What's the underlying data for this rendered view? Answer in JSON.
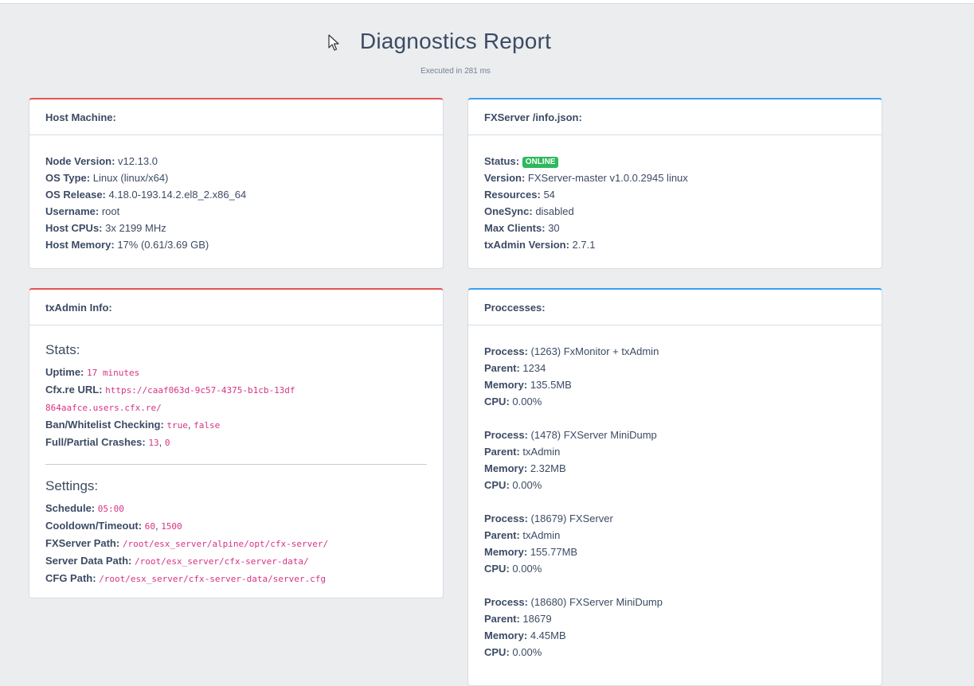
{
  "header": {
    "title": "Diagnostics Report",
    "executed": "Executed in 281 ms"
  },
  "host": {
    "title": "Host Machine:",
    "node_label": "Node Version:",
    "node_value": "v12.13.0",
    "os_type_label": "OS Type:",
    "os_type_value": "Linux (linux/x64)",
    "os_release_label": "OS Release:",
    "os_release_value": "4.18.0-193.14.2.el8_2.x86_64",
    "username_label": "Username:",
    "username_value": "root",
    "cpus_label": "Host CPUs:",
    "cpus_value": "3x 2199 MHz",
    "memory_label": "Host Memory:",
    "memory_value": "17% (0.61/3.69 GB)"
  },
  "fxserver": {
    "title": "FXServer /info.json:",
    "status_label": "Status:",
    "status_value": "ONLINE",
    "status_color": "#2eb85c",
    "version_label": "Version:",
    "version_value": "FXServer-master v1.0.0.2945 linux",
    "resources_label": "Resources:",
    "resources_value": "54",
    "onesync_label": "OneSync:",
    "onesync_value": "disabled",
    "maxclients_label": "Max Clients:",
    "maxclients_value": "30",
    "txadmin_label": "txAdmin Version:",
    "txadmin_value": "2.7.1"
  },
  "txadmin": {
    "title": "txAdmin Info:",
    "stats_title": "Stats:",
    "uptime_label": "Uptime:",
    "uptime_value": "17 minutes",
    "cfx_label": "Cfx.re URL:",
    "cfx_value": "https://caaf063d-9c57-4375-b1cb-13df864aafce.users.cfx.re/",
    "ban_label": "Ban/Whitelist Checking:",
    "ban_value1": "true",
    "ban_value2": "false",
    "crash_label": "Full/Partial Crashes:",
    "crash_value1": "13",
    "crash_value2": "0",
    "settings_title": "Settings:",
    "schedule_label": "Schedule:",
    "schedule_value": "05:00",
    "cooldown_label": "Cooldown/Timeout:",
    "cooldown_value1": "60",
    "cooldown_value2": "1500",
    "fxpath_label": "FXServer Path:",
    "fxpath_value": "/root/esx_server/alpine/opt/cfx-server/",
    "datapath_label": "Server Data Path:",
    "datapath_value": "/root/esx_server/cfx-server-data/",
    "cfgpath_label": "CFG Path:",
    "cfgpath_value": "/root/esx_server/cfx-server-data/server.cfg"
  },
  "processes": {
    "title": "Proccesses:",
    "process_label": "Process:",
    "parent_label": "Parent:",
    "memory_label": "Memory:",
    "cpu_label": "CPU:",
    "items": [
      {
        "process": "(1263) FxMonitor + txAdmin",
        "parent": "1234",
        "memory": "135.5MB",
        "cpu": "0.00%"
      },
      {
        "process": "(1478) FXServer MiniDump",
        "parent": "txAdmin",
        "memory": "2.32MB",
        "cpu": "0.00%"
      },
      {
        "process": "(18679) FXServer",
        "parent": "txAdmin",
        "memory": "155.77MB",
        "cpu": "0.00%"
      },
      {
        "process": "(18680) FXServer MiniDump",
        "parent": "18679",
        "memory": "4.45MB",
        "cpu": "0.00%"
      }
    ]
  }
}
